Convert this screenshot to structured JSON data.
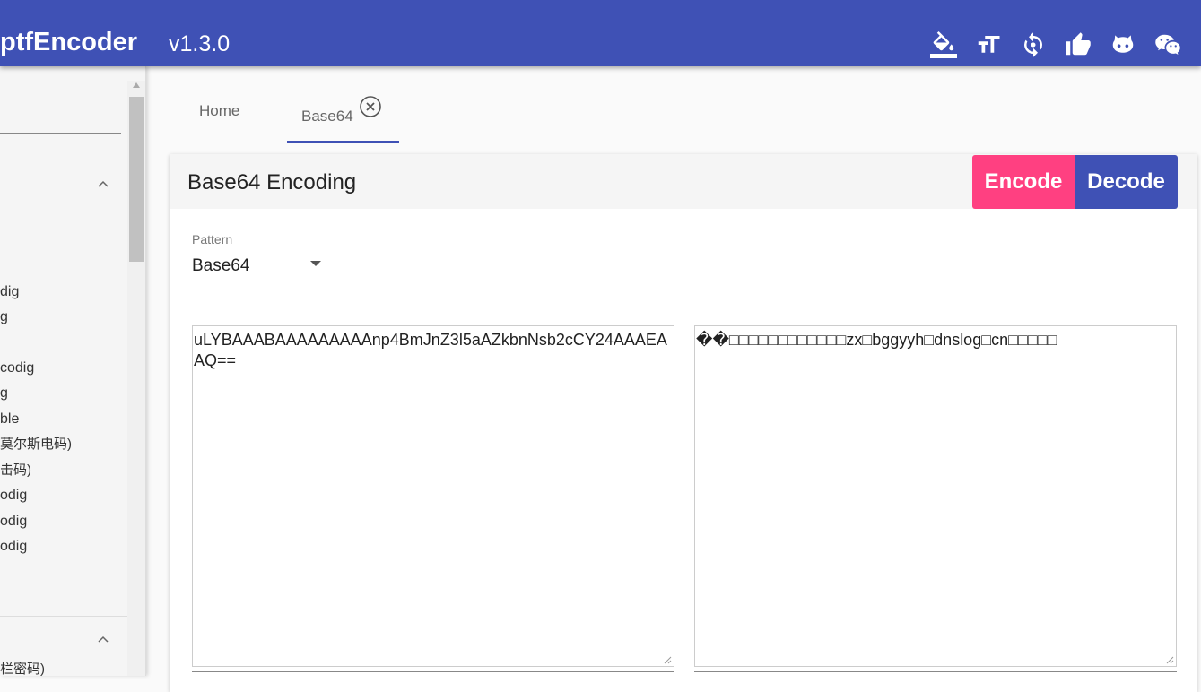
{
  "app": {
    "title": "ptfEncoder",
    "version": "v1.3.0"
  },
  "toolbar": {
    "icons": [
      "paint-bucket-icon",
      "font-size-icon",
      "refresh-icon",
      "thumbs-up-icon",
      "github-icon",
      "wechat-icon"
    ]
  },
  "sidebar": {
    "items": [
      "dig",
      "g",
      "codig",
      "g",
      "ble",
      "莫尔斯电码)",
      "击码)",
      "odig",
      "odig",
      "odig"
    ],
    "bottom_item": "栏密码)"
  },
  "tabs": {
    "home": "Home",
    "base64": "Base64"
  },
  "card": {
    "title": "Base64 Encoding",
    "encode_label": "Encode",
    "decode_label": "Decode",
    "pattern_label": "Pattern",
    "pattern_value": "Base64",
    "input_text": "uLYBAAABAAAAAAAAAnp4BmJnZ3l5aAZkbnNsb2cCY24AAAEAAQ==",
    "output_text": "��□□□□□□□□□□□□zx□bggyyh□dnslog□cn□□□□□"
  },
  "colors": {
    "primary": "#3f51b5",
    "accent": "#ff4081"
  }
}
